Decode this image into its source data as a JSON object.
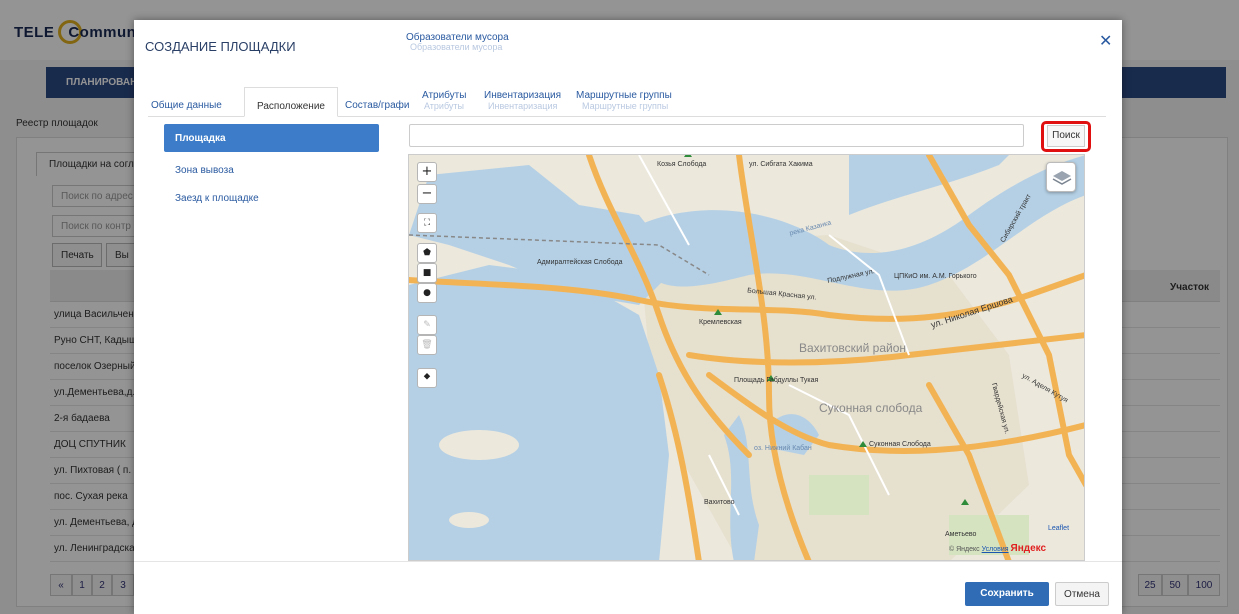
{
  "background": {
    "logo_tele": "TELE",
    "logo_rest": "Communa",
    "nav_label": "ПЛАНИРОВАНИ",
    "breadcrumb": "Реестр площадок",
    "tab_label": "Площадки на согла",
    "inputs": [
      "Поиск по адрес",
      "Поиск по контр"
    ],
    "buttons": [
      "Печать",
      "Вы"
    ],
    "column_right": "Участок",
    "rows": [
      "улица Васильчен",
      "Руно СНТ, Кадыш",
      "поселок Озерный",
      "ул.Дементьева,д.",
      "2-я бадаева",
      "ДОЦ СПУТНИК",
      "ул. Пихтовая ( п.",
      "пос. Сухая река",
      "ул. Дементьева, д",
      "ул. Ленинградска"
    ],
    "pager_left": [
      "«",
      "1",
      "2",
      "3"
    ],
    "pager_right": [
      "25",
      "50",
      "100"
    ]
  },
  "modal": {
    "title": "СОЗДАНИЕ ПЛОЩАДКИ",
    "subtitle": "Образователи мусора",
    "close_icon": "close-icon",
    "tabs": [
      {
        "label": "Общие данные"
      },
      {
        "label": "Расположение"
      },
      {
        "label": "Состав/графи"
      },
      {
        "label": "Атрибуты"
      },
      {
        "label": "Инвентаризация"
      },
      {
        "label": "Маршрутные группы"
      }
    ],
    "sidebar": [
      {
        "label": "Площадка"
      },
      {
        "label": "Зона вывоза"
      },
      {
        "label": "Заезд к площадке"
      }
    ],
    "search": {
      "value": "",
      "button_label": "Поиск"
    },
    "footer": {
      "save_label": "Сохранить",
      "cancel_label": "Отмена"
    }
  },
  "map": {
    "controls": {
      "zoom_in": "+",
      "zoom_out": "−",
      "fullscreen": "⛶",
      "polygon": "⬟",
      "rectangle": "■",
      "circle": "●",
      "edit": "✎",
      "delete": "🗑",
      "marker": "⯁"
    },
    "labels": {
      "kozya": "Козья Слобода",
      "sibgata": "ул. Сибгата Хакима",
      "sibirsky": "Сибирский тракт",
      "kazanka": "река Казанка",
      "admiralteyskaya": "Адмиралтейская Слобода",
      "podluzhnaya": "Подлужная ул.",
      "bolshaya_krasnaya": "Большая Красная ул.",
      "kremlevskaya": "Кремлевская",
      "nikolaya_ershova": "ул. Николая Ершова",
      "vakhitovsky": "Вахитовский район",
      "gabdully_tukaya": "Площадь Габдуллы Тукая",
      "sukonnaya": "Суконная слобода",
      "sukonnaya_metro": "Суконная Слобода",
      "adelya_kutuya": "ул. Аделя Кутуя",
      "gvardeyskaya": "Гвардейская ул.",
      "ametyevo": "Аметьево",
      "kaban": "оз. Нижний Кабан",
      "vakhitovo": "Вахитово",
      "tsiuo": "ЦПКиО им. А.М. Горького"
    },
    "leaflet": "Leaflet",
    "attribution_prefix": "© Яндекс",
    "attribution_link": "Условия",
    "attribution_brand": "Яндекс"
  }
}
